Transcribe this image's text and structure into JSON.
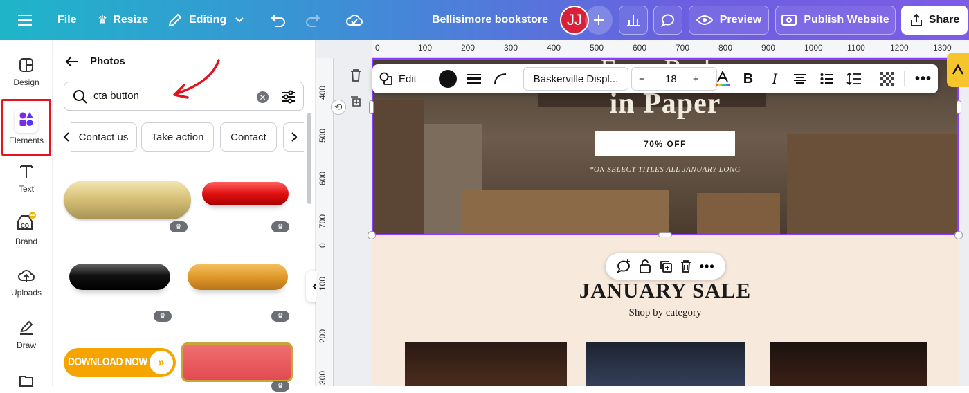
{
  "topbar": {
    "file": "File",
    "resize": "Resize",
    "editing": "Editing",
    "doc_title": "Bellisimore bookstore",
    "avatar": "JJ",
    "preview": "Preview",
    "publish": "Publish Website",
    "share": "Share"
  },
  "rail": [
    {
      "label": "Design",
      "icon": "design-icon"
    },
    {
      "label": "Elements",
      "icon": "elements-icon"
    },
    {
      "label": "Text",
      "icon": "text-icon"
    },
    {
      "label": "Brand",
      "icon": "brand-icon"
    },
    {
      "label": "Uploads",
      "icon": "uploads-icon"
    },
    {
      "label": "Draw",
      "icon": "draw-icon"
    }
  ],
  "panel": {
    "title": "Photos",
    "search_value": "cta button",
    "chips": [
      "Contact us",
      "Take action",
      "Contact"
    ],
    "download_button_text": "DOWNLOAD NOW"
  },
  "ruler": {
    "h": [
      "0",
      "100",
      "200",
      "300",
      "400",
      "500",
      "600",
      "700",
      "800",
      "900",
      "1000",
      "1100",
      "1200",
      "1300"
    ],
    "v": [
      "400",
      "500",
      "600",
      "700",
      "0",
      "100",
      "200",
      "300"
    ]
  },
  "toolbar": {
    "edit": "Edit",
    "font": "Baskerville Displ...",
    "size": "18",
    "minus": "−",
    "plus": "+"
  },
  "design": {
    "partial_title_top": "F       R  d",
    "hero_title": "in Paper",
    "promo": "70% OFF",
    "note": "*ON SELECT TITLES ALL JANUARY LONG",
    "sale_title": "JANUARY SALE",
    "sale_sub": "Shop by category"
  },
  "colors": {
    "accent": "#8b3dff",
    "highlight": "#e6141f",
    "avatar": "#d8203a"
  }
}
